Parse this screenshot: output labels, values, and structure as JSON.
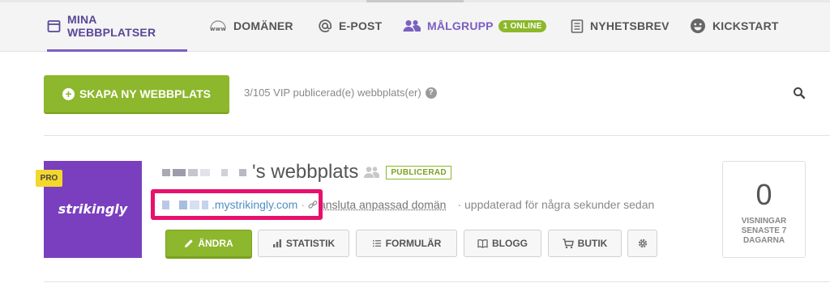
{
  "nav": {
    "sites": "MINA WEBBPLATSER",
    "domains": "DOMÄNER",
    "email": "E-POST",
    "audience": "MÅLGRUPP",
    "online_badge": "1 ONLINE",
    "newsletter": "NYHETSBREV",
    "kickstart": "KICKSTART",
    "domains_icon_text": "www"
  },
  "toolbar": {
    "create_label": "SKAPA NY WEBBPLATS",
    "vip_text": "3/105 VIP publicerad(e) webbplats(er)",
    "help": "?"
  },
  "site": {
    "thumbnail_logo": "strikingly",
    "pro_badge": "PRO",
    "title": "'s webbplats",
    "published_badge": "PUBLICERAD",
    "url_suffix": ".mystrikingly.com",
    "connect_link": "ansluta anpassad domän",
    "updated": "uppdaterad för några sekunder sedan",
    "separator": "·"
  },
  "actions": {
    "edit": "ÄNDRA",
    "stats": "STATISTIK",
    "forms": "FORMULÄR",
    "blog": "BLOGG",
    "store": "BUTIK"
  },
  "views": {
    "count": "0",
    "label": "VISNINGAR SENASTE 7 DAGARNA"
  },
  "colors": {
    "accent_purple": "#7b5fc1",
    "brand_green": "#8db72c",
    "highlight_pink": "#e8106d",
    "pro_yellow": "#f3d72d",
    "thumbnail_purple": "#7a3fbf",
    "link_blue": "#4f8fc4"
  },
  "icons": {
    "nav": [
      "browser-icon",
      "www-icon",
      "at-icon",
      "users-icon",
      "newspaper-icon",
      "smiley-icon"
    ],
    "buttons": [
      "pencil-icon",
      "bar-chart-icon",
      "list-icon",
      "book-icon",
      "cart-icon",
      "gear-icon"
    ],
    "misc": [
      "plus-circle-icon",
      "question-icon",
      "search-icon",
      "user-group-icon",
      "link-icon"
    ]
  }
}
